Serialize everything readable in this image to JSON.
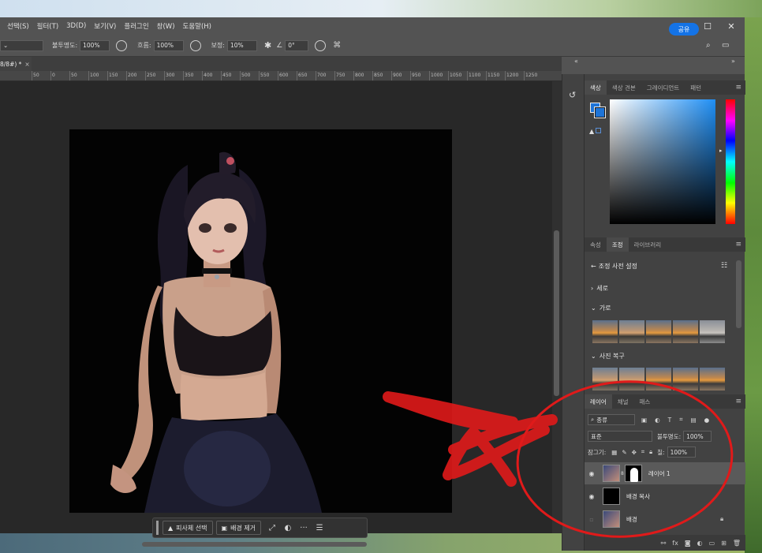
{
  "menu": [
    "선택(S)",
    "필터(T)",
    "3D(D)",
    "보기(V)",
    "플러그인",
    "창(W)",
    "도움말(H)"
  ],
  "window_controls": {
    "minimize": "—",
    "maximize": "☐",
    "close": "✕"
  },
  "options": {
    "opacity_label": "불투명도:",
    "opacity_value": "100%",
    "flow_label": "흐름:",
    "flow_value": "100%",
    "smoothing_label": "보정:",
    "smoothing_value": "10%",
    "angle_value": "0°",
    "share_label": "공유"
  },
  "doc_tab": {
    "title": "8/8#) *",
    "close": "×"
  },
  "ruler": [
    "50",
    "0",
    "50",
    "100",
    "150",
    "200",
    "250",
    "300",
    "350",
    "400",
    "450",
    "500",
    "550",
    "600",
    "650",
    "700",
    "750",
    "800",
    "850",
    "900",
    "950",
    "1000",
    "1050",
    "1100",
    "1150",
    "1200",
    "1250"
  ],
  "taskbar": {
    "select_subject": "피사체 선택",
    "remove_bg": "배경 제거",
    "more": "···"
  },
  "color_panel": {
    "tabs": [
      "색상",
      "색상 견본",
      "그레이디언트",
      "패턴"
    ],
    "foreground": "#1e74d8"
  },
  "adjust_panel": {
    "tabs": [
      "속성",
      "조정",
      "라이브러리"
    ],
    "active_tab": "조정",
    "header": "조정 사전 설정",
    "groups": [
      {
        "label": "세로",
        "expanded": false
      },
      {
        "label": "가로",
        "expanded": true
      },
      {
        "label": "사진 복구",
        "expanded": true
      }
    ]
  },
  "layers_panel": {
    "tabs": [
      "레이어",
      "채널",
      "패스"
    ],
    "filter_kind": "종류",
    "blend_mode": "표준",
    "opacity_label": "불투명도:",
    "opacity_value": "100%",
    "lock_label": "잠그기:",
    "fill_label": "칠:",
    "fill_value": "100%",
    "layers": [
      {
        "name": "레이어 1",
        "visible": true,
        "selected": true
      },
      {
        "name": "배경 복사",
        "visible": true,
        "selected": false
      },
      {
        "name": "배경",
        "visible": false,
        "selected": false
      }
    ],
    "footer": [
      "⚯",
      "fx",
      "◙",
      "◐",
      "▭",
      "⊞",
      "🗑"
    ]
  }
}
